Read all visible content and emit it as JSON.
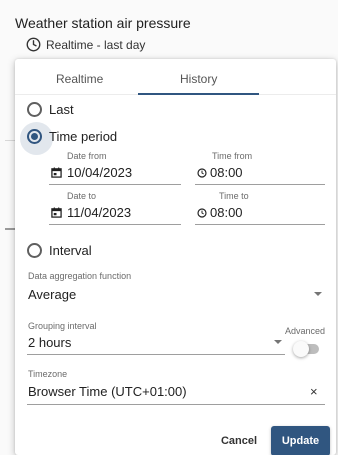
{
  "widget": {
    "title": "Weather station air pressure",
    "subtitle": "Realtime - last day"
  },
  "tabs": [
    {
      "label": "Realtime",
      "active": false
    },
    {
      "label": "History",
      "active": true
    }
  ],
  "history": {
    "options": {
      "last": "Last",
      "time_period": "Time period",
      "interval": "Interval"
    },
    "selected": "time_period",
    "date_from": {
      "label": "Date from",
      "value": "10/04/2023"
    },
    "time_from": {
      "label": "Time from",
      "value": "08:00"
    },
    "date_to": {
      "label": "Date to",
      "value": "11/04/2023"
    },
    "time_to": {
      "label": "Time to",
      "value": "08:00"
    }
  },
  "aggregation": {
    "label": "Data aggregation function",
    "value": "Average"
  },
  "grouping": {
    "label": "Grouping interval",
    "value": "2 hours",
    "advanced_label": "Advanced",
    "advanced_on": false
  },
  "timezone": {
    "label": "Timezone",
    "value": "Browser Time (UTC+01:00)",
    "clear_glyph": "×"
  },
  "actions": {
    "cancel": "Cancel",
    "update": "Update"
  },
  "colors": {
    "accent": "#305680",
    "text": "#212121",
    "muted": "#6b6b6b"
  }
}
